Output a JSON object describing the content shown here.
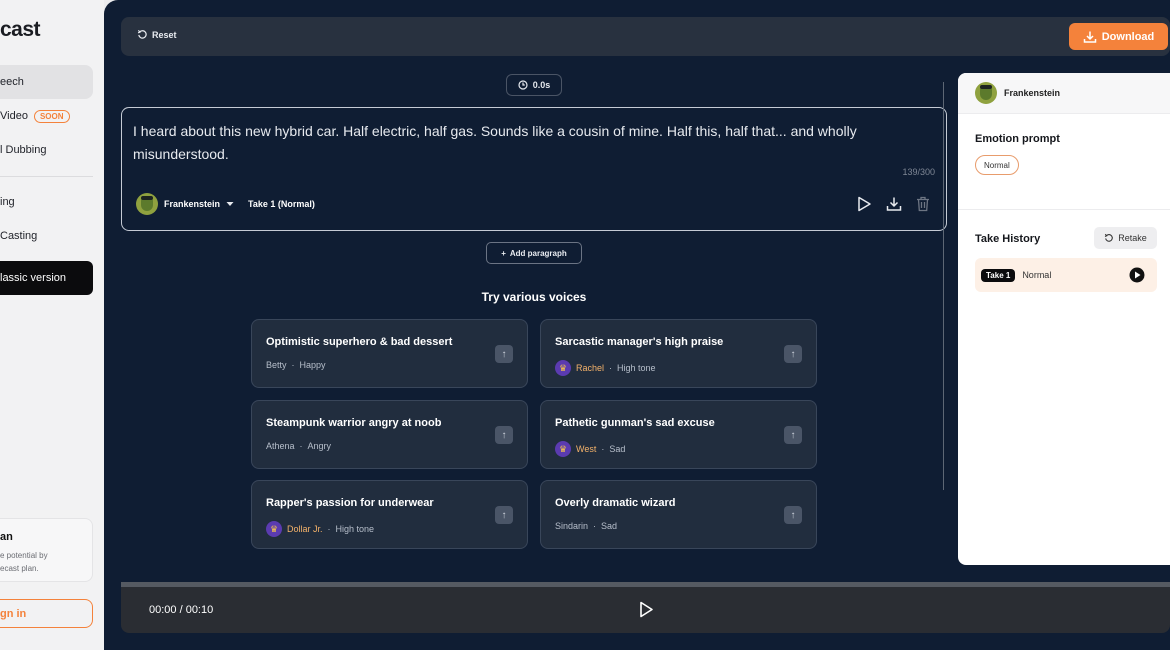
{
  "sidebar": {
    "logo": "cast",
    "items": [
      {
        "label": "eech",
        "badge": ""
      },
      {
        "label": "Video",
        "badge": "SOON"
      },
      {
        "label": "l Dubbing",
        "badge": ""
      },
      {
        "label": "ing",
        "badge": ""
      },
      {
        "label": "Casting",
        "badge": ""
      },
      {
        "label": "lassic version",
        "badge": ""
      }
    ],
    "plan": {
      "title": "an",
      "line1": "e potential by",
      "line2": "ecast plan."
    },
    "signin": "gn in"
  },
  "topbar": {
    "reset": "Reset",
    "download": "Download"
  },
  "timer": "0.0s",
  "editor": {
    "text": "I heard about this new hybrid car. Half electric, half gas. Sounds like a cousin of mine. Half this, half that... and wholly misunderstood.",
    "char_count": "139/300",
    "voice": "Frankenstein",
    "take": "Take 1 (Normal)"
  },
  "add_paragraph": "Add paragraph",
  "try_title": "Try various voices",
  "voice_cards": [
    {
      "title": "Optimistic superhero & bad dessert",
      "speaker": "Betty",
      "emotion": "Happy",
      "premium": false
    },
    {
      "title": "Sarcastic manager's high praise",
      "speaker": "Rachel",
      "emotion": "High tone",
      "premium": true
    },
    {
      "title": "Steampunk warrior angry at noob",
      "speaker": "Athena",
      "emotion": "Angry",
      "premium": false
    },
    {
      "title": "Pathetic gunman's sad excuse",
      "speaker": "West",
      "emotion": "Sad",
      "premium": true
    },
    {
      "title": "Rapper's passion for underwear",
      "speaker": "Dollar Jr.",
      "emotion": "High tone",
      "premium": true
    },
    {
      "title": "Overly dramatic wizard",
      "speaker": "Sindarin",
      "emotion": "Sad",
      "premium": false
    }
  ],
  "separator": "·",
  "player": {
    "time": "00:00 / 00:10"
  },
  "right_panel": {
    "voice": "Frankenstein",
    "emotion_label": "Emotion prompt",
    "emotion_value": "Normal",
    "history_label": "Take History",
    "retake": "Retake",
    "take_badge": "Take 1",
    "take_emotion": "Normal"
  },
  "colors": {
    "accent": "#f4823b",
    "app_bg": "#0f1d33",
    "card_bg": "#212d3e"
  }
}
